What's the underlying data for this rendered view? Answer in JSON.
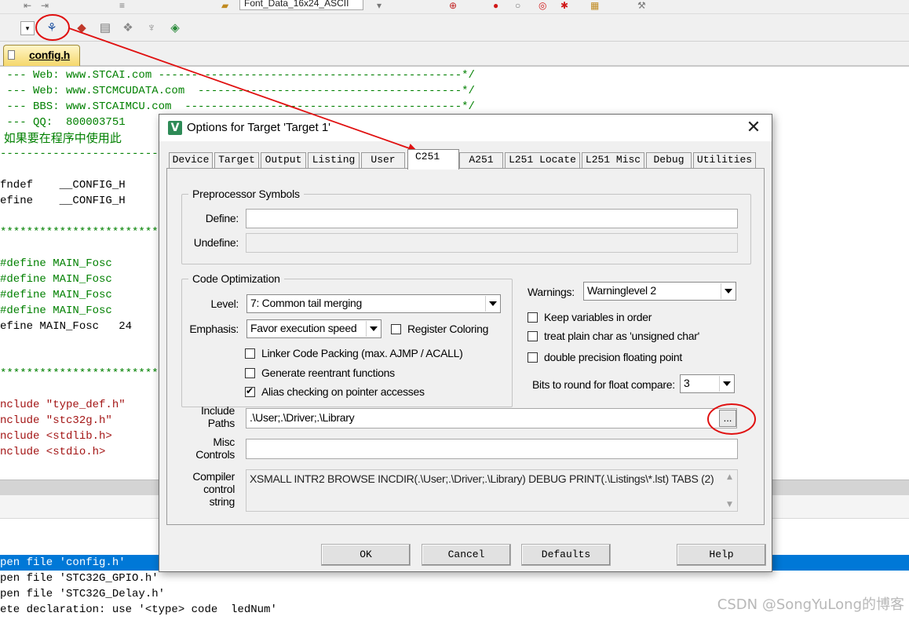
{
  "toolbar": {
    "file_combo": "Font_Data_16x24_ASCII"
  },
  "editor": {
    "tab_label": "config.h",
    "lines": [
      " --- Web: www.STCAI.com ----------------------------------------------*/",
      " --- Web: www.STCMCUDATA.com  ----------------------------------------*/",
      " --- BBS: www.STCAIMCU.com  ------------------------------------------*/",
      " --- QQ:  800003751 ",
      " 如果要在程序中使用此",
      "-------------------------",
      "",
      "fndef    __CONFIG_H",
      "efine    __CONFIG_H",
      "",
      "*************************",
      "",
      "#define MAIN_Fosc    ",
      "#define MAIN_Fosc    ",
      "#define MAIN_Fosc    ",
      "#define MAIN_Fosc    ",
      "efine MAIN_Fosc   24",
      "",
      "",
      "*************************",
      "",
      "nclude \"type_def.h\"",
      "nclude \"stc32g.h\"",
      "nclude <stdlib.h>",
      "nclude <stdio.h>"
    ]
  },
  "build_output": {
    "lines": [
      "pen file 'config.h'",
      "pen file 'STC32G_GPIO.h'",
      "pen file 'STC32G_Delay.h'",
      "ete declaration: use '<type> code  ledNum'"
    ]
  },
  "watermark": "CSDN @SongYuLong的博客",
  "dialog": {
    "title": "Options for Target 'Target 1'",
    "icon_letter": "V",
    "close_glyph": "✕",
    "tabs": [
      "Device",
      "Target",
      "Output",
      "Listing",
      "User",
      "C251",
      "A251",
      "L251 Locate",
      "L251 Misc",
      "Debug",
      "Utilities"
    ],
    "active_tab": "C251",
    "preprocessor": {
      "title": "Preprocessor Symbols",
      "define_label": "Define:",
      "define_value": "",
      "undefine_label": "Undefine:",
      "undefine_value": ""
    },
    "code_opt": {
      "title": "Code Optimization",
      "level_label": "Level:",
      "level_value": "7: Common tail merging",
      "emphasis_label": "Emphasis:",
      "emphasis_value": "Favor execution speed",
      "register_coloring": "Register Coloring",
      "linker_packing": "Linker Code Packing (max. AJMP / ACALL)",
      "reentrant": "Generate reentrant functions",
      "alias": "Alias checking on pointer accesses"
    },
    "warnings": {
      "label": "Warnings:",
      "value": "Warninglevel 2",
      "keep_vars": "Keep variables in order",
      "plain_char": "treat plain char as 'unsigned char'",
      "double_prec": "double precision floating point",
      "bits_label": "Bits to round for float compare:",
      "bits_value": "3"
    },
    "include_label_1": "Include",
    "include_label_2": "Paths",
    "include_value": ".\\User;.\\Driver;.\\Library",
    "browse_label": "...",
    "misc_label_1": "Misc",
    "misc_label_2": "Controls",
    "misc_value": "",
    "compiler_label_1": "Compiler",
    "compiler_label_2": "control",
    "compiler_label_3": "string",
    "compiler_value": "XSMALL INTR2 BROWSE INCDIR(.\\User;.\\Driver;.\\Library) DEBUG PRINT(.\\Listings\\*.lst) TABS (2)",
    "buttons": {
      "ok": "OK",
      "cancel": "Cancel",
      "defaults": "Defaults",
      "help": "Help"
    }
  },
  "colors": {
    "annotation_red": "#e01010",
    "selection_blue": "#0078d7",
    "comment_green": "#008000"
  }
}
